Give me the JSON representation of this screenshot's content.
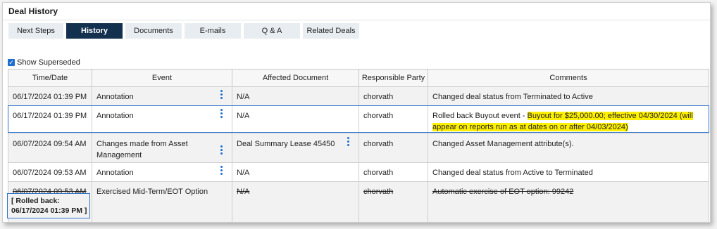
{
  "page": {
    "title": "Deal History"
  },
  "tabs": [
    {
      "label": "Next Steps"
    },
    {
      "label": "History"
    },
    {
      "label": "Documents"
    },
    {
      "label": "E-mails"
    },
    {
      "label": "Q & A"
    },
    {
      "label": "Related Deals"
    }
  ],
  "show_superseded": {
    "label": "Show Superseded",
    "checked": true
  },
  "table": {
    "headers": [
      "Time/Date",
      "Event",
      "Affected Document",
      "Responsible Party",
      "Comments"
    ],
    "rows": [
      {
        "time": "06/17/2024 01:39 PM",
        "event": "Annotation",
        "document": "N/A",
        "party": "chorvath",
        "comments": "Changed deal status from Terminated to Active"
      },
      {
        "time": "06/17/2024 01:39 PM",
        "event": "Annotation",
        "document": "N/A",
        "party": "chorvath",
        "comments_prefix": "Rolled back Buyout event - ",
        "comments_highlight": "Buyout for $25,000.00; effective 04/30/2024 (will appear on reports run as at dates on or after 04/03/2024)"
      },
      {
        "time": "06/07/2024 09:54 AM",
        "event": "Changes made from Asset Management",
        "document": "Deal Summary Lease 45450",
        "party": "chorvath",
        "comments": "Changed Asset Management attribute(s)."
      },
      {
        "time": "06/07/2024 09:53 AM",
        "event": "Annotation",
        "document": "N/A",
        "party": "chorvath",
        "comments": "Changed deal status from Active to Terminated"
      },
      {
        "time": "06/07/2024 09:53 AM",
        "event": "Exercised Mid-Term/EOT Option",
        "document": "N/A",
        "party": "chorvath",
        "comments": "Automatic exercise of EOT option: 99242",
        "superseded": true,
        "rolled_back_label": "[ Rolled back:",
        "rolled_back_time": "06/17/2024 01:39 PM ]"
      }
    ]
  },
  "colors": {
    "active_tab": "#14304f",
    "tab_bg": "#e8edf2",
    "accent": "#1f6fd1",
    "highlight": "#fff000"
  }
}
